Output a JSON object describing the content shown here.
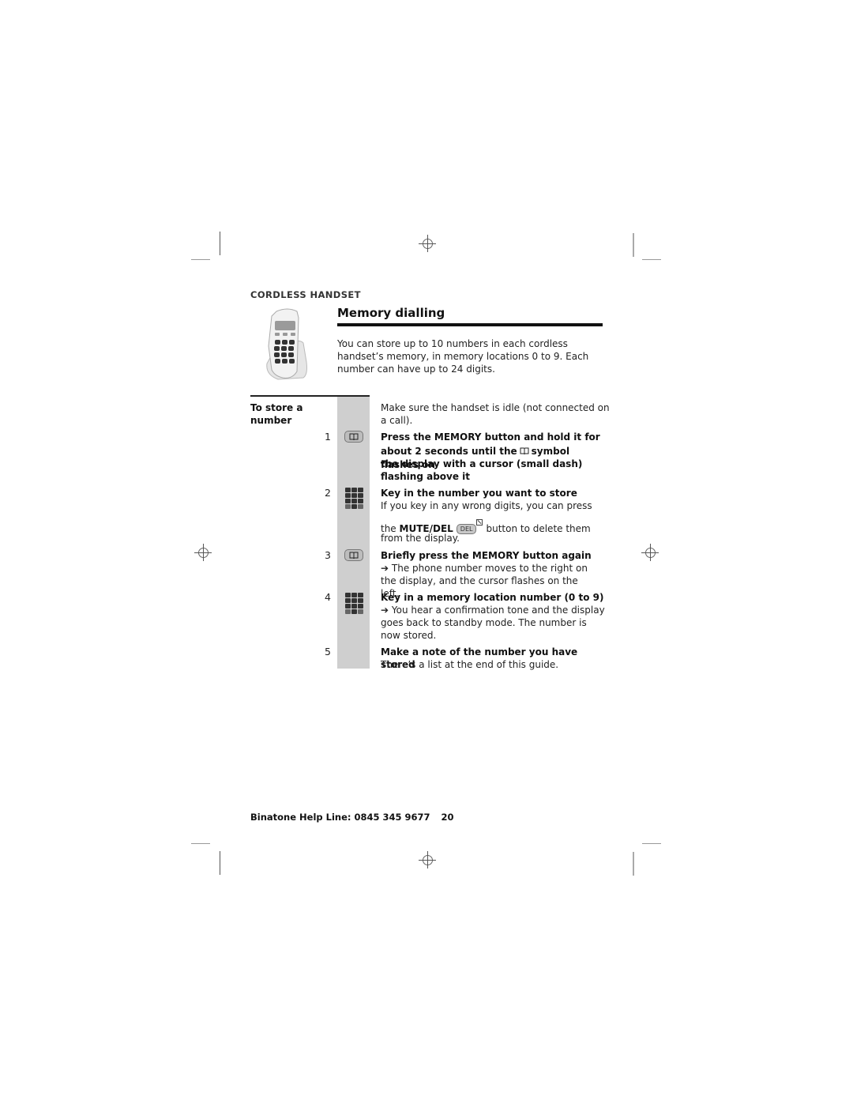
{
  "section": "CORDLESS HANDSET",
  "title": "Memory dialling",
  "intro": "You can store up to 10 numbers in each cordless handset’s memory, in memory locations 0 to 9. Each number can have up to 24 digits.",
  "image": {
    "alt": "cordless handset photo",
    "icon": "phone-handset-icon"
  },
  "procedure": {
    "heading": "To store a number",
    "preamble": "Make sure the handset is idle (not connected on a call).",
    "steps": [
      {
        "number": "1",
        "icon": "memory-book-icon",
        "title_line1": "Press the MEMORY button and hold it for",
        "title_line2a": "about 2 seconds until the",
        "title_line2b": "symbol flashes on",
        "title_rest": "the display with a cursor (small dash) flashing above it"
      },
      {
        "number": "2",
        "icon": "keypad-icon",
        "title": "Key in the number you want to store",
        "body1": "If you key in any wrong digits, you can press",
        "body2_pre": "the",
        "body2_bold": "MUTE/DEL",
        "body2_button": "DEL",
        "body2_post": "button to delete them",
        "body3": "from the display."
      },
      {
        "number": "3",
        "icon": "memory-book-icon",
        "title": "Briefly press the MEMORY button again",
        "arrow": "➔",
        "body": "The phone number moves to the right on the display, and the cursor flashes on the left."
      },
      {
        "number": "4",
        "icon": "keypad-icon",
        "title": "Key in a memory location number (0 to 9)",
        "arrow": "➔",
        "body": "You hear a confirmation tone and the display goes back to standby mode. The number is now stored."
      },
      {
        "number": "5",
        "title": "Make a note of the number you have stored",
        "body": "There’s a list at the end of this guide."
      }
    ]
  },
  "footer": {
    "label": "Binatone Help Line:",
    "phone": "0845 345 9677",
    "page": "20"
  }
}
